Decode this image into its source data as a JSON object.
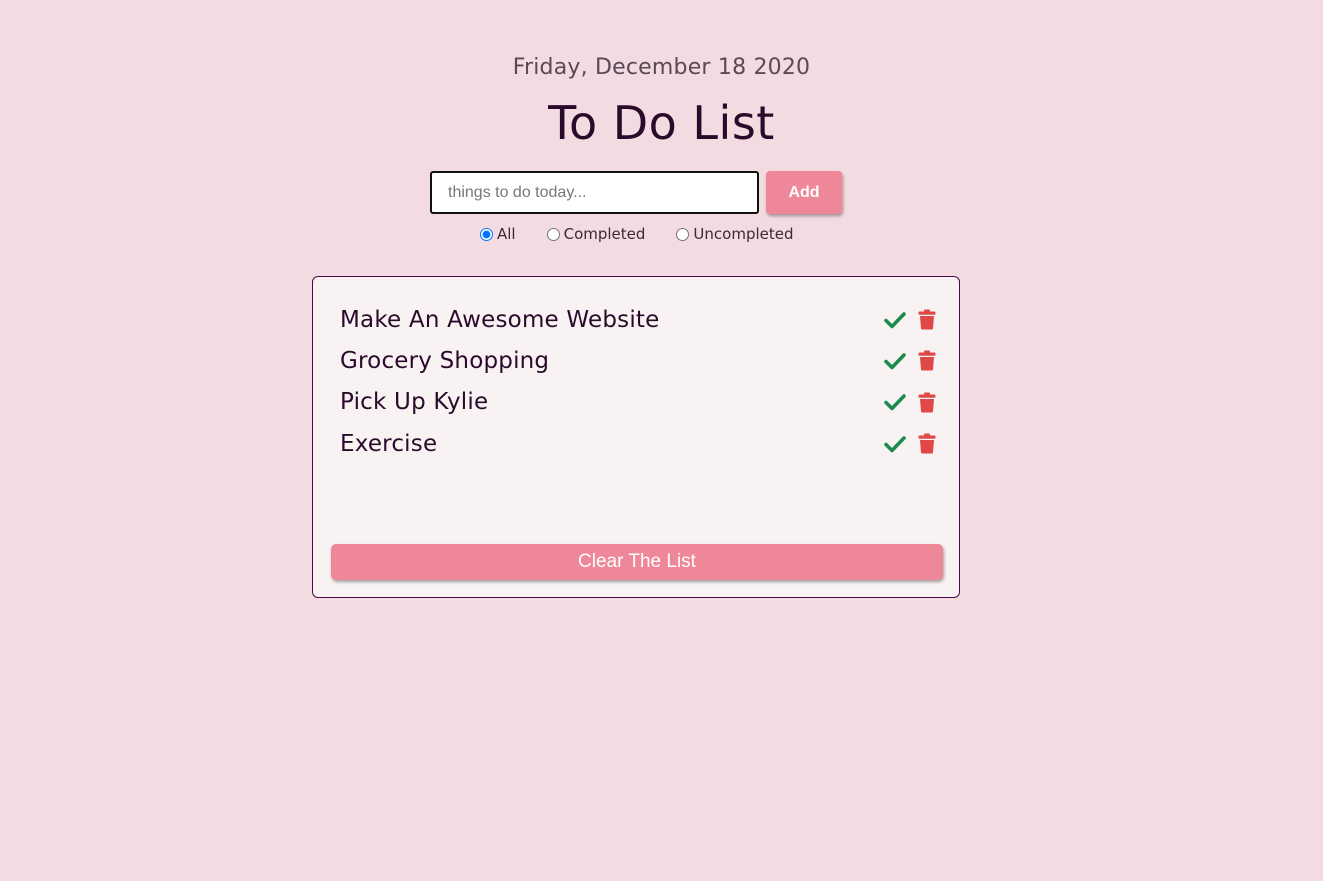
{
  "header": {
    "date": "Friday, December 18 2020",
    "title": "To Do List"
  },
  "form": {
    "input_placeholder": "things to do today...",
    "input_value": "",
    "add_label": "Add"
  },
  "filters": [
    {
      "label": "All",
      "checked": true
    },
    {
      "label": "Completed",
      "checked": false
    },
    {
      "label": "Uncompleted",
      "checked": false
    }
  ],
  "todos": [
    {
      "text": "Make An Awesome Website",
      "complete_icon": "check-icon",
      "delete_icon": "trash-icon"
    },
    {
      "text": "Grocery Shopping",
      "complete_icon": "check-icon",
      "delete_icon": "trash-icon"
    },
    {
      "text": "Pick Up Kylie",
      "complete_icon": "check-icon",
      "delete_icon": "trash-icon"
    },
    {
      "text": "Exercise",
      "complete_icon": "check-icon",
      "delete_icon": "trash-icon"
    }
  ],
  "clear_label": "Clear The List",
  "colors": {
    "background": "#f2dbe1",
    "accent": "#ee8797",
    "check": "#1d8a4e",
    "trash": "#e04848",
    "text": "#2a0a2a"
  }
}
